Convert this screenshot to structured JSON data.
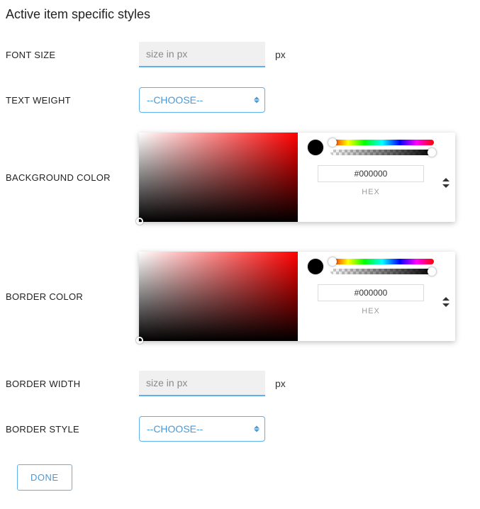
{
  "title": "Active item specific styles",
  "fields": {
    "fontSize": {
      "label": "FONT SIZE",
      "placeholder": "size in px",
      "value": "",
      "unit": "px"
    },
    "textWeight": {
      "label": "TEXT WEIGHT",
      "selected": "--CHOOSE--"
    },
    "backgroundColor": {
      "label": "BACKGROUND COLOR",
      "hex": "#000000",
      "formatLabel": "HEX"
    },
    "borderColor": {
      "label": "BORDER COLOR",
      "hex": "#000000",
      "formatLabel": "HEX"
    },
    "borderWidth": {
      "label": "BORDER WIDTH",
      "placeholder": "size in px",
      "value": "",
      "unit": "px"
    },
    "borderStyle": {
      "label": "BORDER STYLE",
      "selected": "--CHOOSE--"
    }
  },
  "doneLabel": "DONE"
}
